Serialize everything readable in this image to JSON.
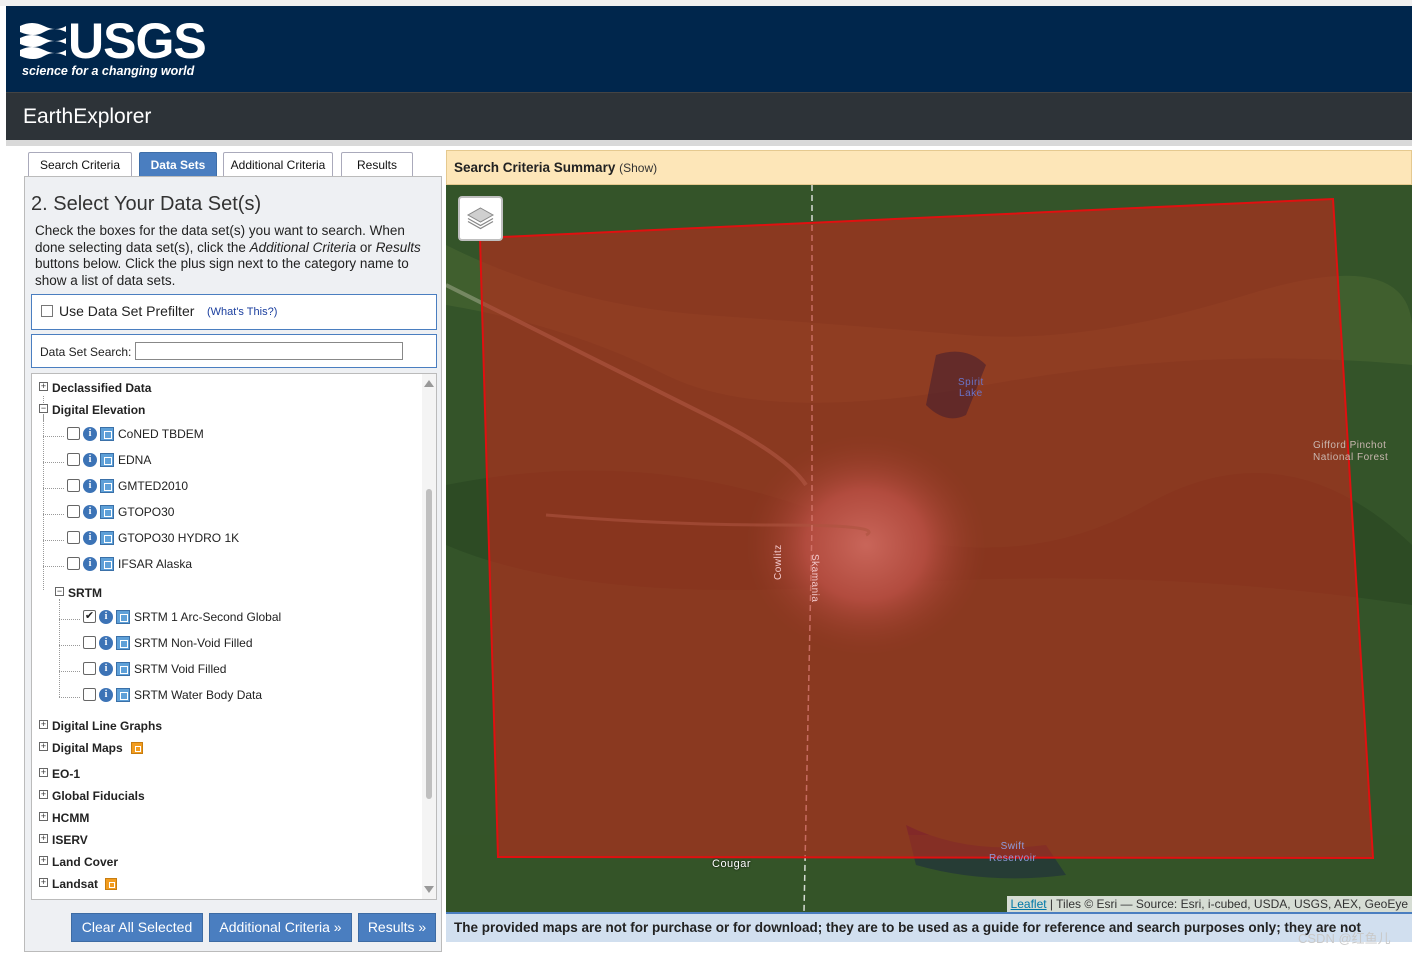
{
  "header": {
    "logo_text": "USGS",
    "tagline": "science for a changing world",
    "app_title": "EarthExplorer"
  },
  "tabs": [
    {
      "label": "Search Criteria",
      "active": false
    },
    {
      "label": "Data Sets",
      "active": true
    },
    {
      "label": "Additional Criteria",
      "active": false
    },
    {
      "label": "Results",
      "active": false
    }
  ],
  "panel": {
    "heading": "2. Select Your Data Set(s)",
    "intro_part1": "Check the boxes for the data set(s) you want to search. When done selecting data set(s), click the ",
    "intro_em1": "Additional Criteria",
    "intro_mid": " or ",
    "intro_em2": "Results",
    "intro_part2": " buttons below. Click the plus sign next to the category name to show a list of data sets.",
    "prefilter_label": "Use Data Set Prefilter",
    "prefilter_help": "(What's This?)",
    "search_label": "Data Set Search:",
    "search_value": ""
  },
  "tree": {
    "categories_top": [
      {
        "label": "Declassified Data",
        "expanded": false
      },
      {
        "label": "Digital Elevation",
        "expanded": true
      }
    ],
    "digital_elevation": [
      {
        "label": "CoNED TBDEM",
        "checked": false
      },
      {
        "label": "EDNA",
        "checked": false
      },
      {
        "label": "GMTED2010",
        "checked": false
      },
      {
        "label": "GTOPO30",
        "checked": false
      },
      {
        "label": "GTOPO30 HYDRO 1K",
        "checked": false
      },
      {
        "label": "IFSAR Alaska",
        "checked": false
      }
    ],
    "srtm_label": "SRTM",
    "srtm": [
      {
        "label": "SRTM 1 Arc-Second Global",
        "checked": true
      },
      {
        "label": "SRTM Non-Void Filled",
        "checked": false
      },
      {
        "label": "SRTM Void Filled",
        "checked": false
      },
      {
        "label": "SRTM Water Body Data",
        "checked": false
      }
    ],
    "categories_bottom": [
      {
        "label": "Digital Line Graphs",
        "badge": false
      },
      {
        "label": "Digital Maps",
        "badge": true
      },
      {
        "label": "EO-1",
        "badge": false
      },
      {
        "label": "Global Fiducials",
        "badge": false
      },
      {
        "label": "HCMM",
        "badge": false
      },
      {
        "label": "ISERV",
        "badge": false
      },
      {
        "label": "Land Cover",
        "badge": false
      },
      {
        "label": "Landsat",
        "badge": true
      }
    ]
  },
  "buttons": {
    "clear": "Clear All Selected",
    "additional": "Additional Criteria »",
    "results": "Results »"
  },
  "summary": {
    "title": "Search Criteria Summary",
    "show": "(Show)"
  },
  "map": {
    "labels": {
      "spirit_lake_1": "Spirit",
      "spirit_lake_2": "Lake",
      "gifford_1": "Gifford Pinchot",
      "gifford_2": "National Forest",
      "cowlitz": "Cowlitz",
      "skamania": "Skamania",
      "cougar": "Cougar",
      "swift_1": "Swift",
      "swift_2": "Reservoir"
    },
    "attribution_link": "Leaflet",
    "attribution_text": " | Tiles © Esri — Source: Esri, i-cubed, USDA, USGS, AEX, GeoEye"
  },
  "disclaimer": "The provided maps are not for purchase or for download; they are to be used as a guide for reference and search purposes only; they are not",
  "watermark": "CSDN @红鱼儿",
  "colors": {
    "header_bg": "#00264c",
    "app_bar_bg": "#2d3338",
    "accent": "#4a7ec0",
    "summary_bg": "#fde6b8",
    "aoi_fill": "#c0281c"
  }
}
